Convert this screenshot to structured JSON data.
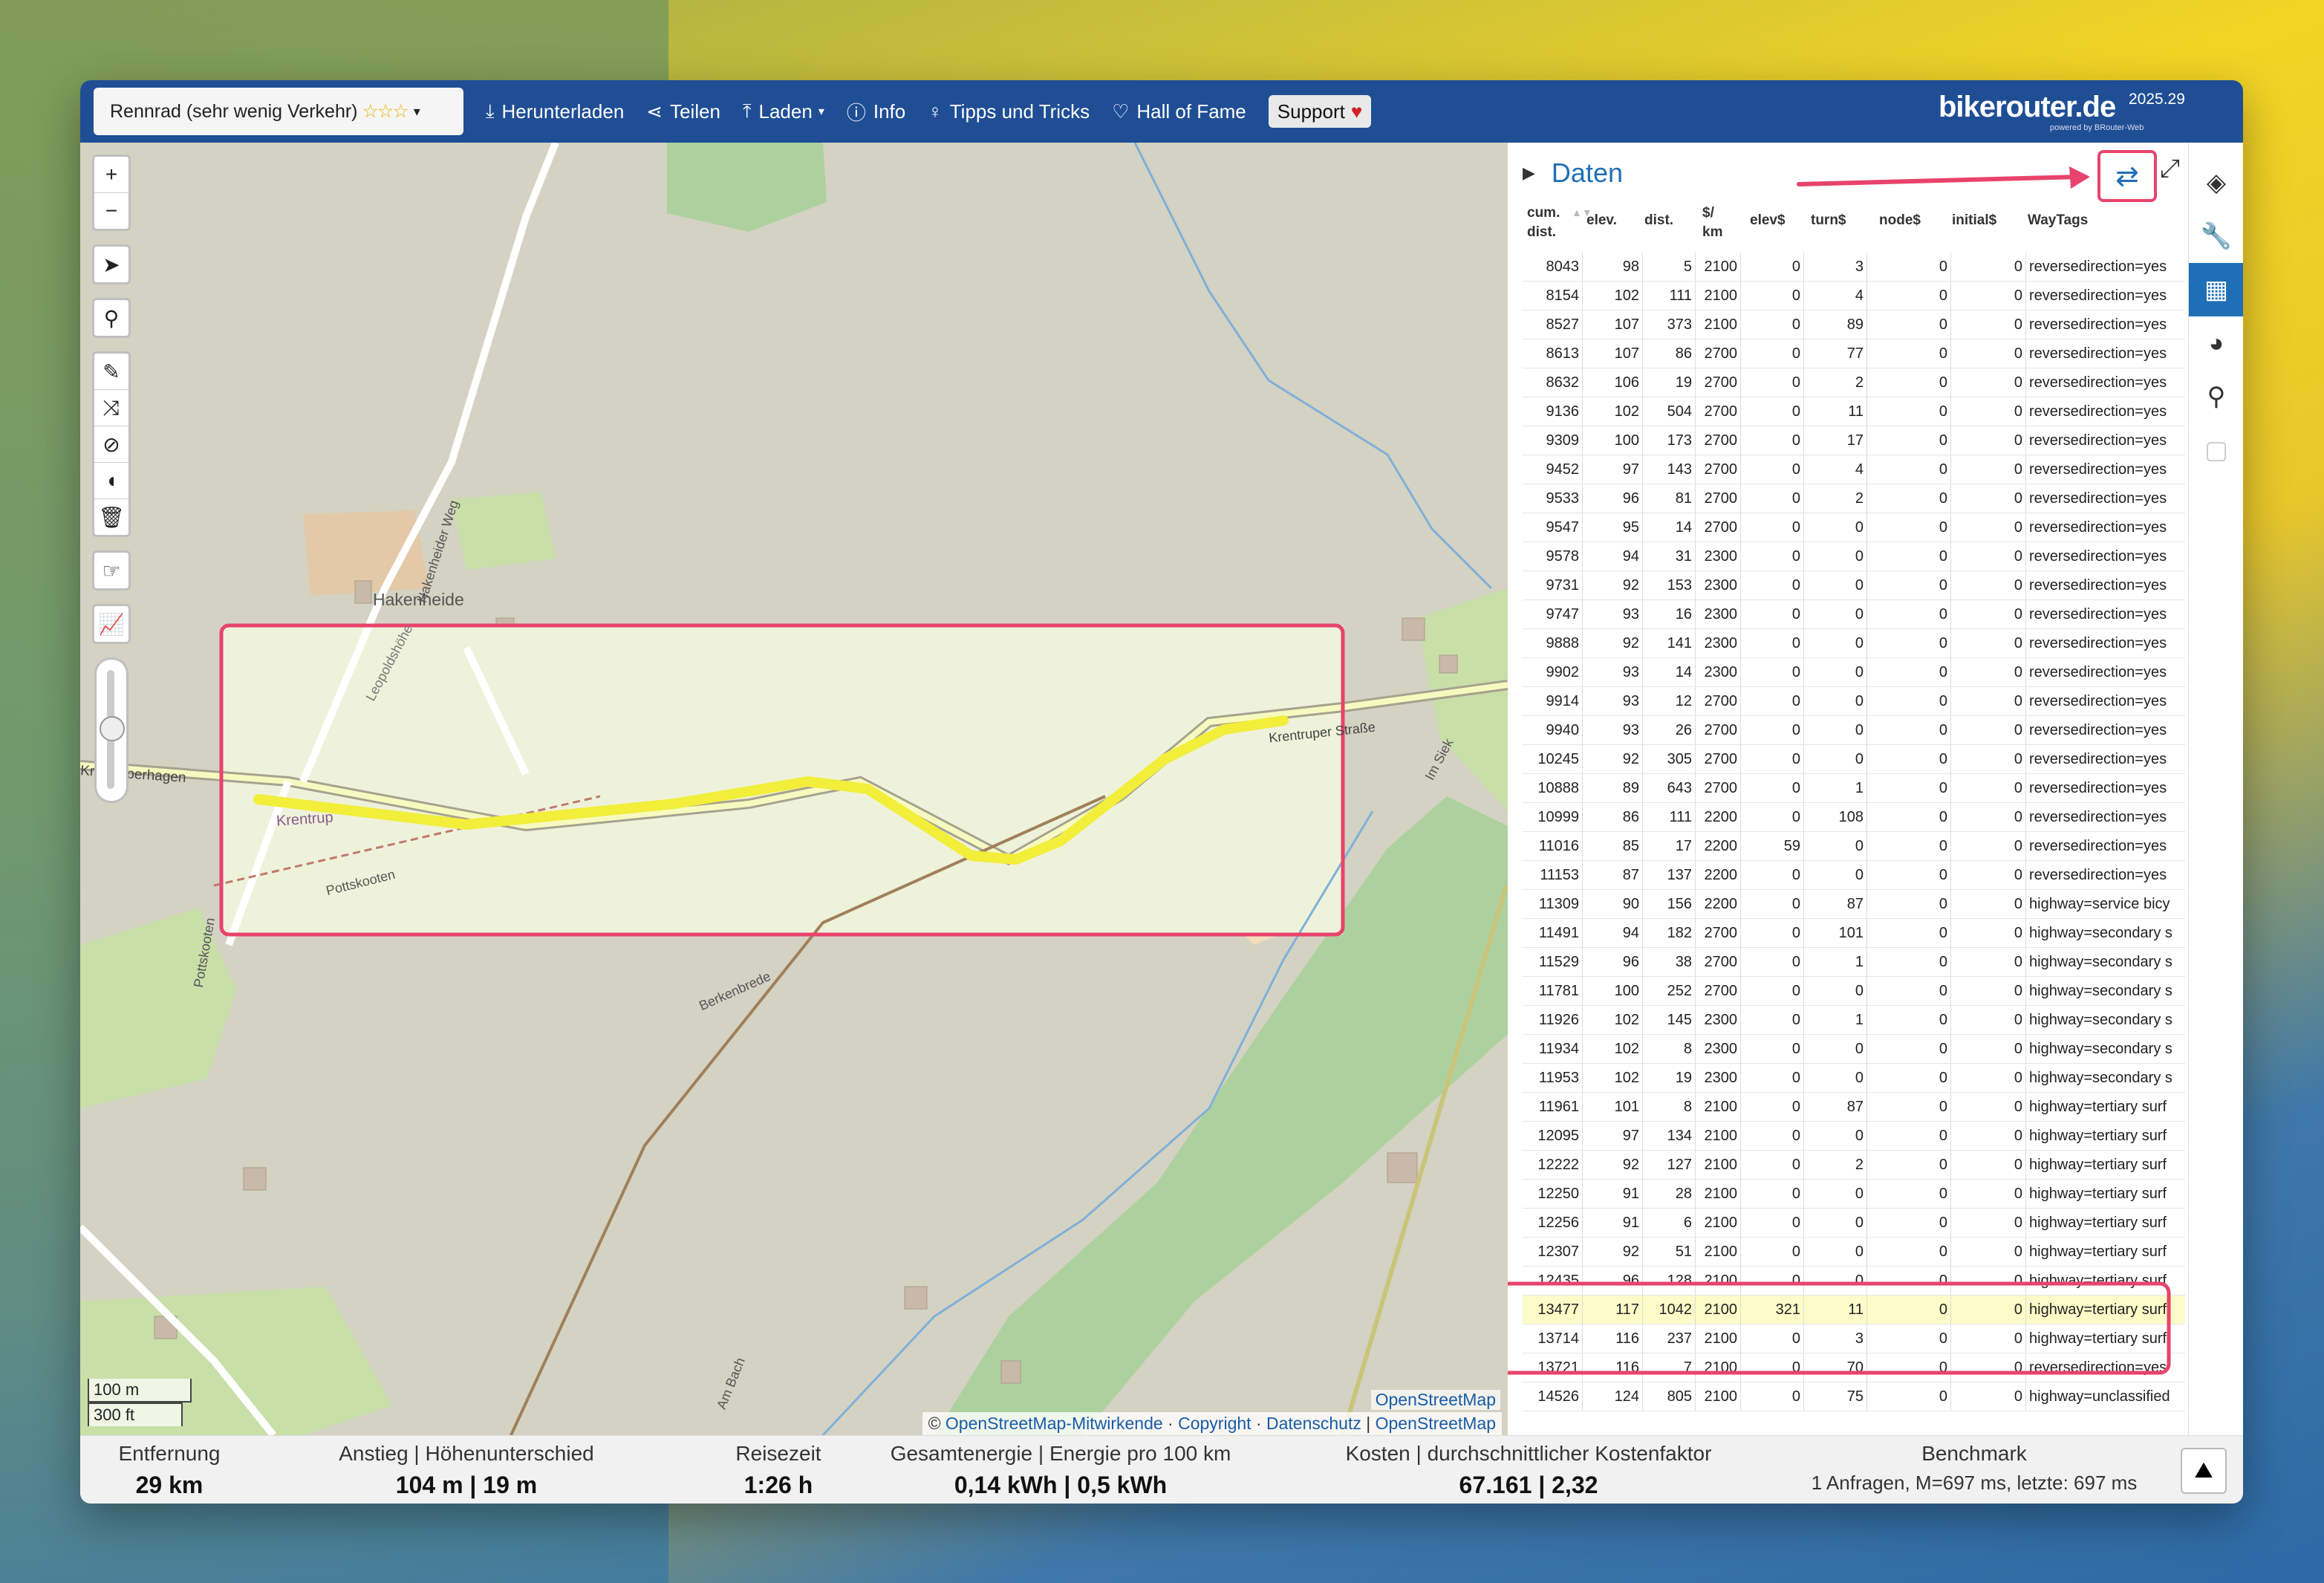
{
  "topbar": {
    "profile": "Rennrad (sehr wenig Verkehr)",
    "profile_stars": "☆☆☆",
    "download": "Herunterladen",
    "share": "Teilen",
    "load": "Laden",
    "info": "Info",
    "tips": "Tipps und Tricks",
    "hall_of_fame": "Hall of Fame",
    "support": "Support",
    "brand": "bikerouter.de",
    "version": "2025.29",
    "powered": "powered by BRouter-Web"
  },
  "map": {
    "labels": {
      "hakenheide": "Hakenheide",
      "krentrup": "Krentrup",
      "pottskooten": "Pottskooten",
      "pottskooten2": "Pottskooten",
      "berkenbrede": "Berkenbrede",
      "krentruper": "Krentruper Straße",
      "krentruperhagen": "Krentruperhagen",
      "hakenheider_weg": "Hakenheider Weg",
      "imsiek": "Im Siek",
      "ambach": "Am Bach",
      "leopold": "Leopoldshöhe"
    },
    "scale_m": "100 m",
    "scale_ft": "300 ft",
    "attribution_prefix": "©",
    "attribution_osm": "OpenStreetMap-Mitwirkende",
    "attribution_copyright": "Copyright",
    "attribution_privacy": "Datenschutz",
    "attribution_layer": "OpenStreetMap",
    "layer_tag": "OpenStreetMap"
  },
  "panel": {
    "title": "Daten",
    "headers": [
      "cum. dist.",
      "elev.",
      "dist.",
      "$/ km",
      "elev$",
      "turn$",
      "node$",
      "initial$",
      "WayTags"
    ],
    "rows": [
      [
        "8043",
        "98",
        "5",
        "2100",
        "0",
        "3",
        "0",
        "0",
        "reversedirection=yes"
      ],
      [
        "8154",
        "102",
        "111",
        "2100",
        "0",
        "4",
        "0",
        "0",
        "reversedirection=yes"
      ],
      [
        "8527",
        "107",
        "373",
        "2100",
        "0",
        "89",
        "0",
        "0",
        "reversedirection=yes"
      ],
      [
        "8613",
        "107",
        "86",
        "2700",
        "0",
        "77",
        "0",
        "0",
        "reversedirection=yes"
      ],
      [
        "8632",
        "106",
        "19",
        "2700",
        "0",
        "2",
        "0",
        "0",
        "reversedirection=yes"
      ],
      [
        "9136",
        "102",
        "504",
        "2700",
        "0",
        "11",
        "0",
        "0",
        "reversedirection=yes"
      ],
      [
        "9309",
        "100",
        "173",
        "2700",
        "0",
        "17",
        "0",
        "0",
        "reversedirection=yes"
      ],
      [
        "9452",
        "97",
        "143",
        "2700",
        "0",
        "4",
        "0",
        "0",
        "reversedirection=yes"
      ],
      [
        "9533",
        "96",
        "81",
        "2700",
        "0",
        "2",
        "0",
        "0",
        "reversedirection=yes"
      ],
      [
        "9547",
        "95",
        "14",
        "2700",
        "0",
        "0",
        "0",
        "0",
        "reversedirection=yes"
      ],
      [
        "9578",
        "94",
        "31",
        "2300",
        "0",
        "0",
        "0",
        "0",
        "reversedirection=yes"
      ],
      [
        "9731",
        "92",
        "153",
        "2300",
        "0",
        "0",
        "0",
        "0",
        "reversedirection=yes"
      ],
      [
        "9747",
        "93",
        "16",
        "2300",
        "0",
        "0",
        "0",
        "0",
        "reversedirection=yes"
      ],
      [
        "9888",
        "92",
        "141",
        "2300",
        "0",
        "0",
        "0",
        "0",
        "reversedirection=yes"
      ],
      [
        "9902",
        "93",
        "14",
        "2300",
        "0",
        "0",
        "0",
        "0",
        "reversedirection=yes"
      ],
      [
        "9914",
        "93",
        "12",
        "2700",
        "0",
        "0",
        "0",
        "0",
        "reversedirection=yes"
      ],
      [
        "9940",
        "93",
        "26",
        "2700",
        "0",
        "0",
        "0",
        "0",
        "reversedirection=yes"
      ],
      [
        "10245",
        "92",
        "305",
        "2700",
        "0",
        "0",
        "0",
        "0",
        "reversedirection=yes"
      ],
      [
        "10888",
        "89",
        "643",
        "2700",
        "0",
        "1",
        "0",
        "0",
        "reversedirection=yes"
      ],
      [
        "10999",
        "86",
        "111",
        "2200",
        "0",
        "108",
        "0",
        "0",
        "reversedirection=yes"
      ],
      [
        "11016",
        "85",
        "17",
        "2200",
        "59",
        "0",
        "0",
        "0",
        "reversedirection=yes"
      ],
      [
        "11153",
        "87",
        "137",
        "2200",
        "0",
        "0",
        "0",
        "0",
        "reversedirection=yes"
      ],
      [
        "11309",
        "90",
        "156",
        "2200",
        "0",
        "87",
        "0",
        "0",
        "highway=service bicy"
      ],
      [
        "11491",
        "94",
        "182",
        "2700",
        "0",
        "101",
        "0",
        "0",
        "highway=secondary s"
      ],
      [
        "11529",
        "96",
        "38",
        "2700",
        "0",
        "1",
        "0",
        "0",
        "highway=secondary s"
      ],
      [
        "11781",
        "100",
        "252",
        "2700",
        "0",
        "0",
        "0",
        "0",
        "highway=secondary s"
      ],
      [
        "11926",
        "102",
        "145",
        "2300",
        "0",
        "1",
        "0",
        "0",
        "highway=secondary s"
      ],
      [
        "11934",
        "102",
        "8",
        "2300",
        "0",
        "0",
        "0",
        "0",
        "highway=secondary s"
      ],
      [
        "11953",
        "102",
        "19",
        "2300",
        "0",
        "0",
        "0",
        "0",
        "highway=secondary s"
      ],
      [
        "11961",
        "101",
        "8",
        "2100",
        "0",
        "87",
        "0",
        "0",
        "highway=tertiary surf"
      ],
      [
        "12095",
        "97",
        "134",
        "2100",
        "0",
        "0",
        "0",
        "0",
        "highway=tertiary surf"
      ],
      [
        "12222",
        "92",
        "127",
        "2100",
        "0",
        "2",
        "0",
        "0",
        "highway=tertiary surf"
      ],
      [
        "12250",
        "91",
        "28",
        "2100",
        "0",
        "0",
        "0",
        "0",
        "highway=tertiary surf"
      ],
      [
        "12256",
        "91",
        "6",
        "2100",
        "0",
        "0",
        "0",
        "0",
        "highway=tertiary surf"
      ],
      [
        "12307",
        "92",
        "51",
        "2100",
        "0",
        "0",
        "0",
        "0",
        "highway=tertiary surf"
      ],
      [
        "12435",
        "96",
        "128",
        "2100",
        "0",
        "0",
        "0",
        "0",
        "highway=tertiary surf"
      ],
      [
        "13477",
        "117",
        "1042",
        "2100",
        "321",
        "11",
        "0",
        "0",
        "highway=tertiary surf"
      ],
      [
        "13714",
        "116",
        "237",
        "2100",
        "0",
        "3",
        "0",
        "0",
        "highway=tertiary surf"
      ],
      [
        "13721",
        "116",
        "7",
        "2100",
        "0",
        "70",
        "0",
        "0",
        "reversedirection=yes"
      ],
      [
        "14526",
        "124",
        "805",
        "2100",
        "0",
        "75",
        "0",
        "0",
        "highway=unclassified"
      ]
    ],
    "highlighted_row": 36
  },
  "stats": {
    "distance_label": "Entfernung",
    "distance_value": "29 km",
    "ascent_label": "Anstieg | Höhenunterschied",
    "ascent_value": "104 m | 19 m",
    "time_label": "Reisezeit",
    "time_value": "1:26 h",
    "energy_label": "Gesamtenergie | Energie pro 100 km",
    "energy_value": "0,14 kWh | 0,5 kWh",
    "cost_label": "Kosten | durchschnittlicher Kostenfaktor",
    "cost_value": "67.161 | 2,32",
    "bench_label": "Benchmark",
    "bench_value": "1 Anfragen, M=697 ms, letzte: 697 ms"
  },
  "colors": {
    "topbar": "#1f4e95",
    "accent": "#1f6fb7",
    "annotation": "#e8436c",
    "route": "#f3ef3a",
    "highlight_row": "#fdfbc8"
  }
}
